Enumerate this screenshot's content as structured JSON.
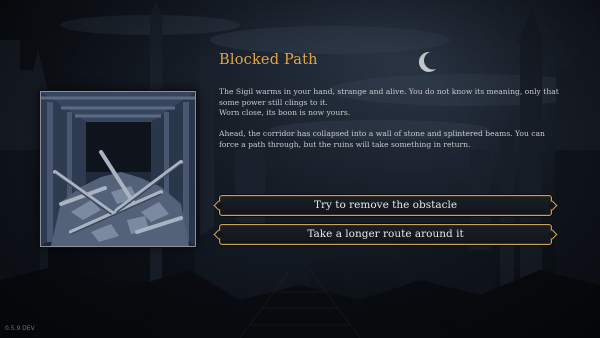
{
  "event": {
    "title": "Blocked Path",
    "paragraphs": [
      "The Sigil warms in your hand, strange and alive. You do not know its meaning, only that some power still clings to it.",
      "Worn close, its boon is now yours.",
      "Ahead, the corridor has collapsed into a wall of stone and splintered beams. You can force a path through, but the ruins will take something in return."
    ],
    "illustration_icon": "collapsed-corridor-illustration"
  },
  "choices": [
    {
      "label": "Try to remove the obstacle"
    },
    {
      "label": "Take a longer route around it"
    }
  ],
  "footer": {
    "version": "0.5.9 DEV"
  },
  "colors": {
    "title_gold": "#e0a54a",
    "button_border_gold": "#caa159",
    "body_text": "#c7c9cc",
    "background": "#0d1117"
  }
}
